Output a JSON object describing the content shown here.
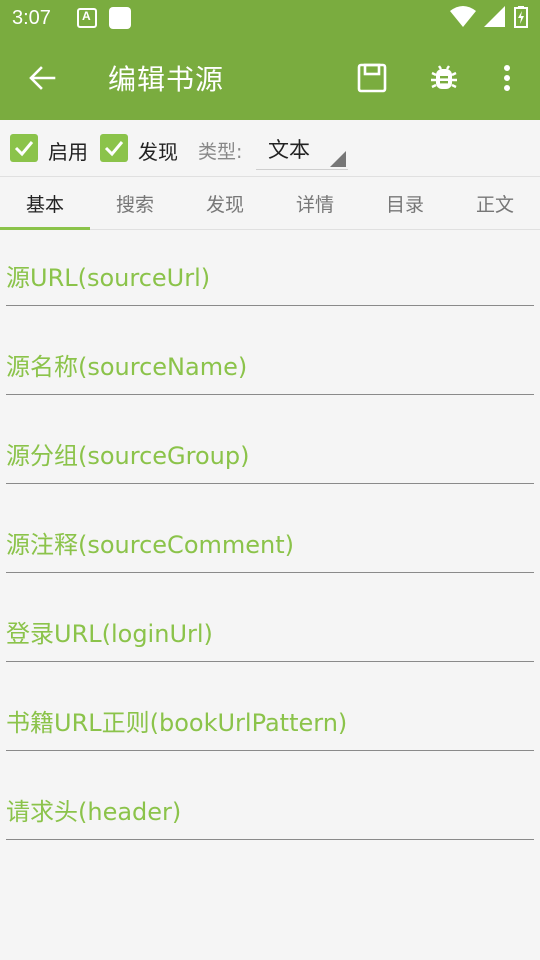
{
  "status_bar": {
    "time": "3:07",
    "app_icon_letter": "A"
  },
  "toolbar": {
    "title": "编辑书源",
    "back_icon": "arrow-left-icon",
    "save_icon": "save-icon",
    "debug_icon": "bug-icon",
    "more_icon": "more-vertical-icon"
  },
  "options": {
    "enabled_label": "启用",
    "enabled_checked": true,
    "discover_label": "发现",
    "discover_checked": true,
    "type_label": "类型:",
    "type_value": "文本"
  },
  "tabs": [
    {
      "label": "基本",
      "active": true
    },
    {
      "label": "搜索",
      "active": false
    },
    {
      "label": "发现",
      "active": false
    },
    {
      "label": "详情",
      "active": false
    },
    {
      "label": "目录",
      "active": false
    },
    {
      "label": "正文",
      "active": false
    }
  ],
  "fields": [
    {
      "placeholder": "源URL(sourceUrl)",
      "value": ""
    },
    {
      "placeholder": "源名称(sourceName)",
      "value": ""
    },
    {
      "placeholder": "源分组(sourceGroup)",
      "value": ""
    },
    {
      "placeholder": "源注释(sourceComment)",
      "value": ""
    },
    {
      "placeholder": "登录URL(loginUrl)",
      "value": ""
    },
    {
      "placeholder": "书籍URL正则(bookUrlPattern)",
      "value": ""
    },
    {
      "placeholder": "请求头(header)",
      "value": ""
    }
  ],
  "colors": {
    "app_bar": "#7aac3f",
    "accent": "#8bc34a",
    "background": "#f5f5f5"
  }
}
